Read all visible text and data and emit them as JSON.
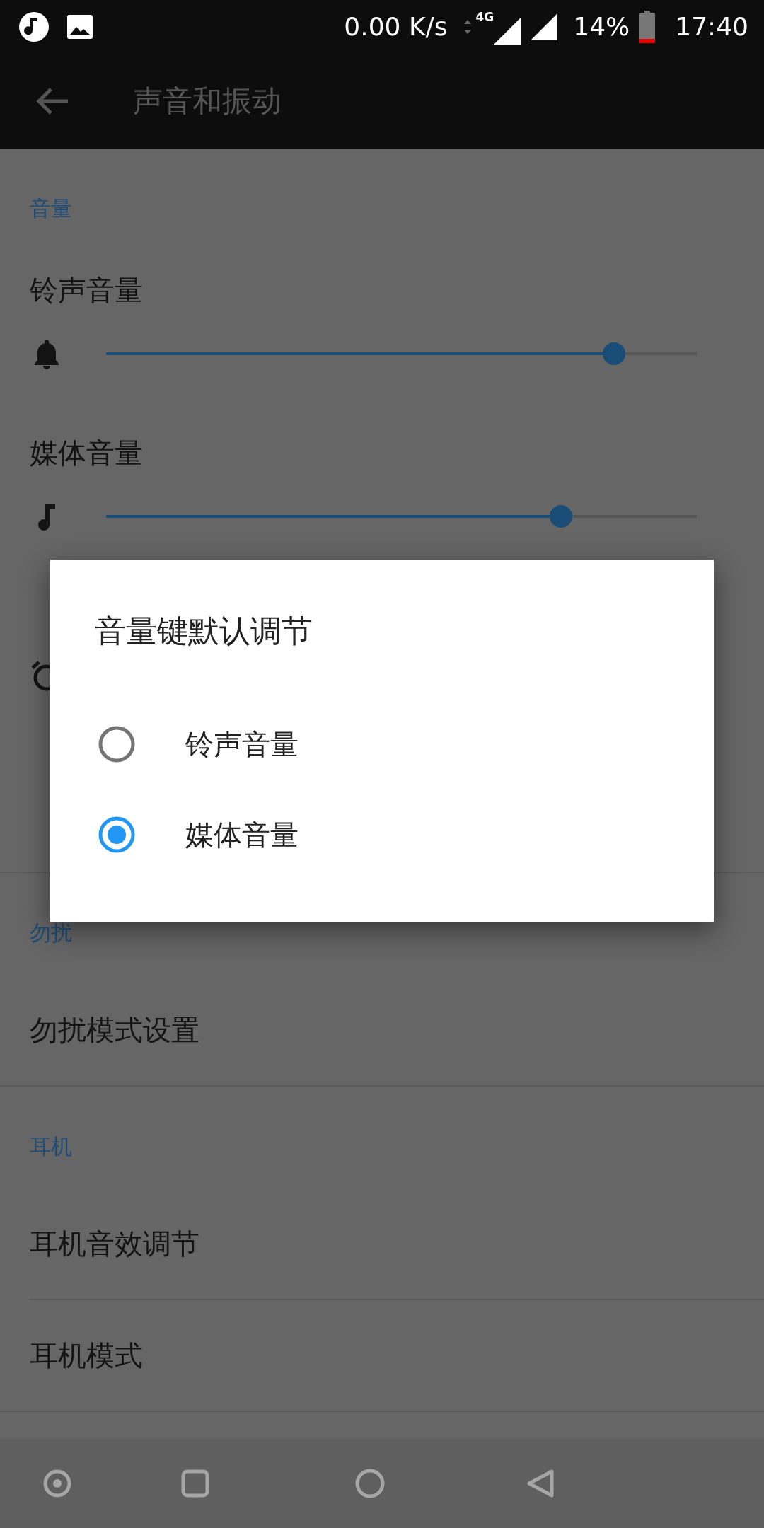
{
  "status_bar": {
    "network_speed": "0.00 K/s",
    "network_type": "4G",
    "battery": "14%",
    "time": "17:40"
  },
  "app_bar": {
    "title": "声音和振动"
  },
  "sections": [
    {
      "header": "音量",
      "items": [
        {
          "kind": "slider",
          "label": "铃声音量",
          "level": 0.86
        },
        {
          "kind": "slider",
          "label": "媒体音量",
          "level": 0.77
        },
        {
          "kind": "covered"
        }
      ]
    },
    {
      "header": "勿扰",
      "items": [
        {
          "kind": "text",
          "label": "勿扰模式设置"
        }
      ]
    },
    {
      "header": "耳机",
      "items": [
        {
          "kind": "text",
          "label": "耳机音效调节"
        },
        {
          "kind": "text",
          "label": "耳机模式"
        }
      ]
    }
  ],
  "dialog": {
    "title": "音量键默认调节",
    "options": [
      {
        "label": "铃声音量",
        "selected": false
      },
      {
        "label": "媒体音量",
        "selected": true
      }
    ]
  }
}
